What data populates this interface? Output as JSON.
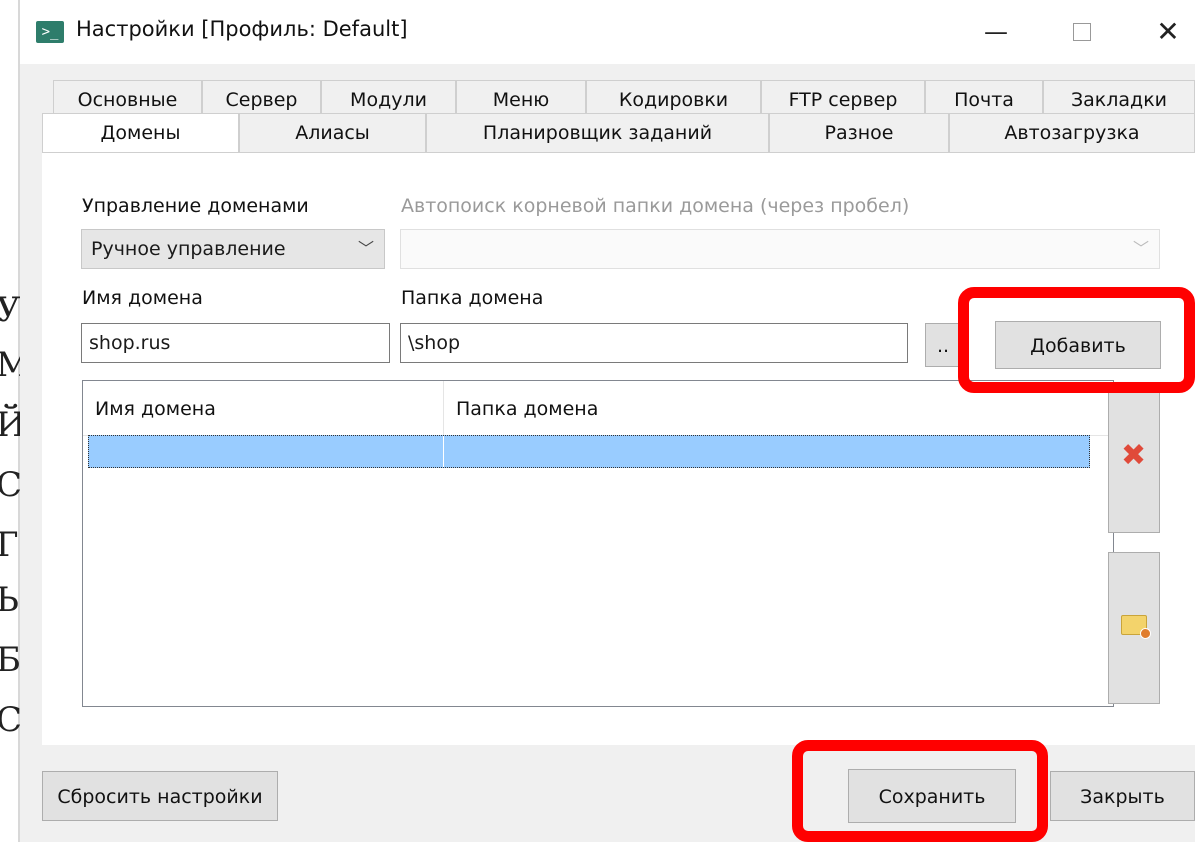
{
  "background_doc": {
    "glyphs": [
      "Ус",
      "М",
      "Й",
      "С",
      "Г",
      "Ь",
      "Б",
      "С"
    ]
  },
  "window": {
    "title": "Настройки [Профиль: Default]",
    "icon": "terminal-icon",
    "controls": {
      "minimize": "—",
      "maximize": "maximize-icon",
      "close": "✕"
    }
  },
  "tabs": {
    "row1": [
      "Основные",
      "Сервер",
      "Модули",
      "Меню",
      "Кодировки",
      "FTP сервер",
      "Почта",
      "Закладки"
    ],
    "row2": [
      "Домены",
      "Алиасы",
      "Планировщик заданий",
      "Разное",
      "Автозагрузка"
    ],
    "active": "Домены"
  },
  "domains": {
    "management_label": "Управление доменами",
    "management_value": "Ручное управление",
    "autosearch_label": "Автопоиск корневой папки домена (через пробел)",
    "autosearch_value": "",
    "name_label": "Имя домена",
    "name_value": "shop.rus",
    "folder_label": "Папка домена",
    "folder_value": "\\shop",
    "browse_label": "..",
    "add_label": "Добавить",
    "table": {
      "columns": [
        "Имя домена",
        "Папка домена"
      ],
      "rows": [
        {
          "name": "",
          "folder": ""
        }
      ]
    },
    "side_buttons": [
      "delete-icon",
      "folder-edit-icon"
    ]
  },
  "footer": {
    "reset_label": "Сбросить настройки",
    "save_label": "Сохранить",
    "close_label": "Закрыть"
  },
  "annotation_color": "#ff0000"
}
